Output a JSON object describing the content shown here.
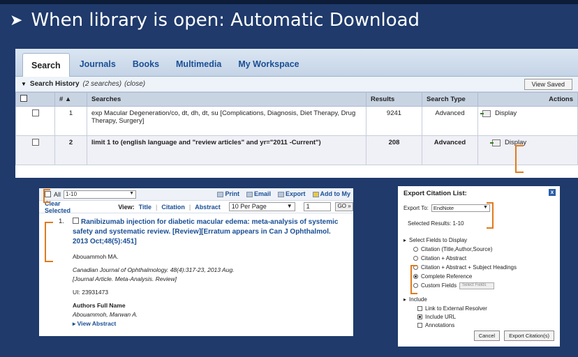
{
  "slide": {
    "title": "When library is open:  Automatic Download",
    "bullet": "➤"
  },
  "tabs": [
    "Search",
    "Journals",
    "Books",
    "Multimedia",
    "My Workspace"
  ],
  "search_history": {
    "title": "Search History",
    "count": "(2 searches)",
    "close": "(close)",
    "view_saved": "View Saved",
    "columns": [
      "#",
      "Searches",
      "Results",
      "Search Type",
      "Actions"
    ],
    "sort_marker": "# ▲",
    "rows": [
      {
        "num": "1",
        "search": "exp Macular Degeneration/co, dt, dh, dt, su [Complications, Diagnosis, Diet Therapy, Drug Therapy, Surgery]",
        "results": "9241",
        "type": "Advanced",
        "action": "Display"
      },
      {
        "num": "2",
        "search": "limit 1 to (english language and \"review articles\" and yr=\"2011 -Current\")",
        "results": "208",
        "type": "Advanced",
        "action": "Display"
      }
    ]
  },
  "results_panel": {
    "all_label": "All",
    "range_value": "1-10",
    "print": "Print",
    "email": "Email",
    "export": "Export",
    "add_to": "Add to My",
    "clear_selected": "Clear Selected",
    "view_label": "View:",
    "view_options": [
      "Title",
      "Citation",
      "Abstract"
    ],
    "per_page": "10 Per Page",
    "page_num": "1",
    "go": "GO »",
    "result": {
      "num": "1.",
      "title": "Ranibizumab injection for diabetic macular edema: meta-analysis of systemic safety and systematic review. [Review][Erratum appears in Can J Ophthalmol. 2013 Oct;48(5):451]",
      "author": "Abouammoh MA.",
      "journal": "Canadian Journal of Ophthalmology. 48(4):317-23, 2013 Aug.",
      "pubtype": "[Journal Article. Meta-Analysis. Review]",
      "ui": "UI: 23931473",
      "full_name_label": "Authors Full Name",
      "full_name": "Abouammoh, Marwan A.",
      "view_abstract": "View Abstract"
    }
  },
  "export_panel": {
    "title": "Export Citation List:",
    "close": "x",
    "export_to_label": "Export To:",
    "export_to_value": "EndNote",
    "selected_results": "Selected Results:  1-10",
    "select_fields": "Select Fields to Display",
    "field_options": [
      {
        "label": "Citation (Title,Author,Source)",
        "selected": false
      },
      {
        "label": "Citation + Abstract",
        "selected": false
      },
      {
        "label": "Citation + Abstract + Subject Headings",
        "selected": false
      },
      {
        "label": "Complete Reference",
        "selected": true
      },
      {
        "label": "Custom Fields",
        "selected": false
      }
    ],
    "custom_btn": "Select Fields",
    "include": "Include",
    "include_options": [
      {
        "label": "Link to External Resolver",
        "checked": false
      },
      {
        "label": "Include URL",
        "checked": true
      },
      {
        "label": "Annotations",
        "checked": false
      }
    ],
    "cancel": "Cancel",
    "export_btn": "Export Citation(s)"
  },
  "colors": {
    "background": "#1f3a6b",
    "link": "#1a4f95",
    "bracket": "#e07a1d"
  }
}
